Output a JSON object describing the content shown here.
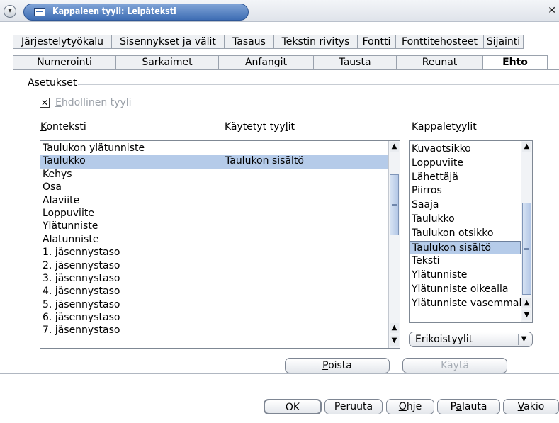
{
  "window": {
    "title": "Kappaleen tyyli: Leipäteksti"
  },
  "tabs_row1": [
    {
      "label": "Järjestelytyökalu",
      "w": 140
    },
    {
      "label": "Sisennykset ja välit",
      "w": 159
    },
    {
      "label": "Tasaus",
      "w": 70
    },
    {
      "label": "Tekstin rivitys",
      "w": 118
    },
    {
      "label": "Fontti",
      "w": 54
    },
    {
      "label": "Fonttitehosteet",
      "w": 124
    },
    {
      "label": "Sijainti",
      "w": 56
    }
  ],
  "tabs_row2": [
    {
      "label": "Numerointi",
      "w": 146
    },
    {
      "label": "Sarkaimet",
      "w": 145
    },
    {
      "label": "Anfangit",
      "w": 134
    },
    {
      "label": "Tausta",
      "w": 117
    },
    {
      "label": "Reunat",
      "w": 122
    },
    {
      "label": "Ehto",
      "w": 91,
      "active": true
    }
  ],
  "settings": {
    "legend": "Asetukset",
    "conditional_checkbox": {
      "checked": true,
      "label_accel": "E",
      "label_rest": "hdollinen tyyli"
    }
  },
  "columns": {
    "context_accel": "K",
    "context_rest": "onteksti",
    "applied_prefix": "Käytetyt tyy",
    "applied_accel": "l",
    "applied_suffix": "it",
    "parastyles_prefix": "Kappalet",
    "parastyles_accel": "y",
    "parastyles_suffix": "ylit"
  },
  "context_rows": [
    {
      "context": "Taulukon ylätunniste",
      "applied": ""
    },
    {
      "context": "Taulukko",
      "applied": "Taulukon sisältö",
      "selected": true
    },
    {
      "context": "Kehys",
      "applied": ""
    },
    {
      "context": "Osa",
      "applied": ""
    },
    {
      "context": "Alaviite",
      "applied": ""
    },
    {
      "context": "Loppuviite",
      "applied": ""
    },
    {
      "context": "Ylätunniste",
      "applied": ""
    },
    {
      "context": "Alatunniste",
      "applied": ""
    },
    {
      "context": " 1. jäsennystaso",
      "applied": ""
    },
    {
      "context": " 2. jäsennystaso",
      "applied": ""
    },
    {
      "context": " 3. jäsennystaso",
      "applied": ""
    },
    {
      "context": " 4. jäsennystaso",
      "applied": ""
    },
    {
      "context": " 5. jäsennystaso",
      "applied": ""
    },
    {
      "context": " 6. jäsennystaso",
      "applied": ""
    },
    {
      "context": " 7. jäsennystaso",
      "applied": ""
    }
  ],
  "paragraph_styles": [
    {
      "label": "Kuvaotsikko"
    },
    {
      "label": "Loppuviite"
    },
    {
      "label": "Lähettäjä"
    },
    {
      "label": "Piirros"
    },
    {
      "label": "Saaja"
    },
    {
      "label": "Taulukko"
    },
    {
      "label": "Taulukon otsikko"
    },
    {
      "label": "Taulukon sisältö",
      "selected": true
    },
    {
      "label": "Teksti"
    },
    {
      "label": "Ylätunniste"
    },
    {
      "label": "Ylätunniste oikealla"
    },
    {
      "label": "Ylätunniste vasemmalla"
    }
  ],
  "style_filter": {
    "selected": "Erikoistyylit"
  },
  "buttons": {
    "remove_accel": "P",
    "remove_rest": "oista",
    "apply": "Käytä",
    "ok": "OK",
    "cancel": "Peruuta",
    "help_accel": "O",
    "help_rest": "hje",
    "reset_prefix": "P",
    "reset_accel": "a",
    "reset_rest": "lauta",
    "default_accel": "V",
    "default_rest": "akio"
  }
}
